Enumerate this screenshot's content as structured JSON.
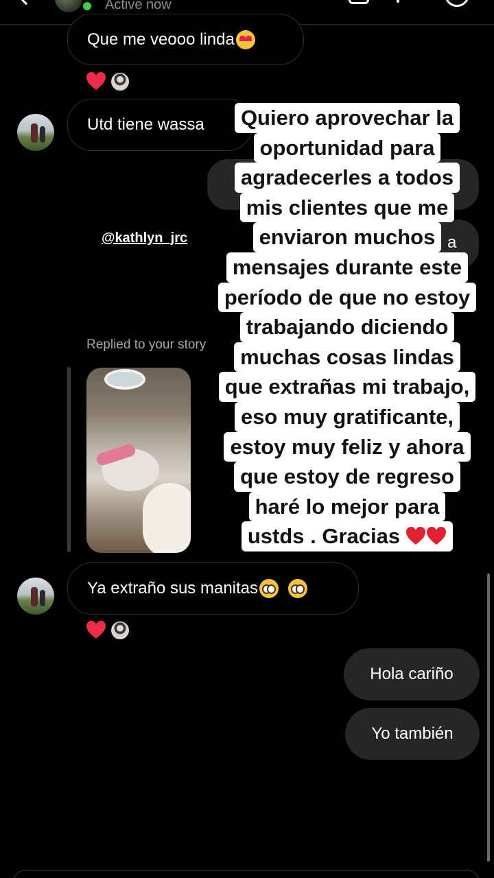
{
  "header": {
    "status": "Active now"
  },
  "messages": {
    "m1": {
      "text": "Que me veooo linda"
    },
    "m2": {
      "text": "Utd tiene wassa"
    },
    "mention": "@kathlyn_jrc",
    "fragment_a": "a",
    "replied_label": "Replied to your story",
    "m3": {
      "text": "Ya extraño sus manitas"
    },
    "m4": {
      "text": "Hola cariño"
    },
    "m5": {
      "text": "Yo también"
    }
  },
  "overlay_lines": [
    "Quiero aprovechar la",
    "oportunidad para",
    "agradecerles a todos",
    "mis clientes que me",
    "enviaron muchos",
    "mensajes durante este",
    "período de que no estoy",
    "trabajando diciendo",
    "muchas cosas lindas",
    "que extrañas mi trabajo,",
    "eso muy gratificante,",
    "estoy muy feliz y ahora",
    "que estoy de regreso",
    "haré lo mejor para",
    "ustds . Gracias"
  ],
  "icons": {
    "reaction": "heart-icon",
    "emoji_love": "heart-eyes-emoji",
    "emoji_plead": "pleading-face-emoji"
  },
  "colors": {
    "background": "#000000",
    "outgoing_bubble": "#262626",
    "heart": "#ed2c4a",
    "online": "#3ecf4b"
  }
}
